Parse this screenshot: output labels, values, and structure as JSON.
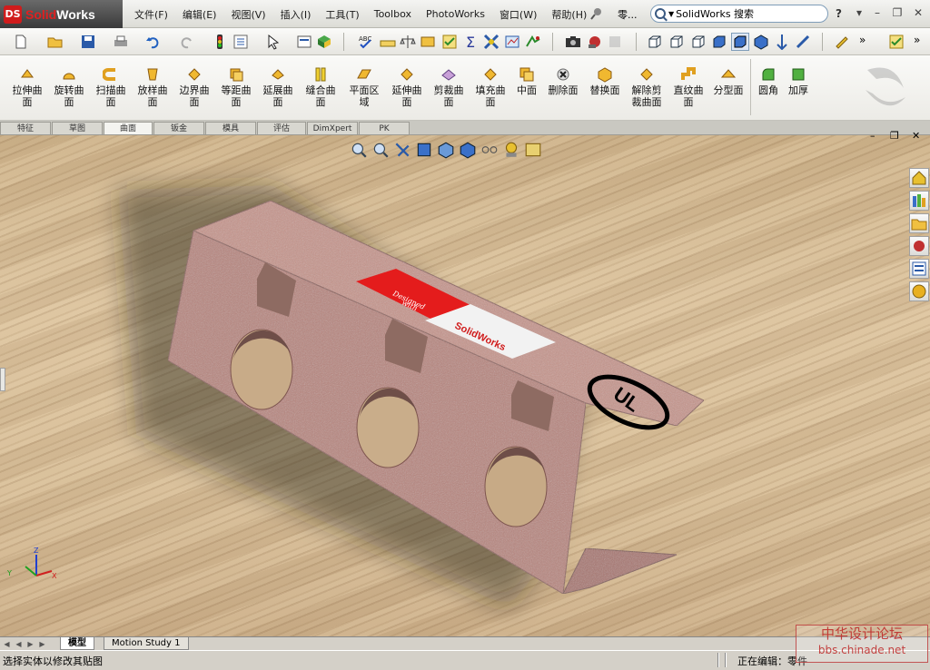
{
  "app": {
    "brand_prefix": "Solid",
    "brand_suffix": "Works",
    "document_label": "零...",
    "search_text": "SolidWorks 搜索",
    "help": "?"
  },
  "menu": [
    "文件(F)",
    "编辑(E)",
    "视图(V)",
    "插入(I)",
    "工具(T)",
    "Toolbox",
    "PhotoWorks",
    "窗口(W)",
    "帮助(H)"
  ],
  "window_buttons": {
    "minimize": "–",
    "restore": "❐",
    "close": "✕"
  },
  "ribbon": {
    "commands": [
      {
        "l1": "拉伸曲",
        "l2": "面"
      },
      {
        "l1": "旋转曲",
        "l2": "面"
      },
      {
        "l1": "扫描曲",
        "l2": "面"
      },
      {
        "l1": "放样曲",
        "l2": "面"
      },
      {
        "l1": "边界曲",
        "l2": "面"
      },
      {
        "l1": "等距曲",
        "l2": "面"
      },
      {
        "l1": "延展曲",
        "l2": "面"
      },
      {
        "l1": "缝合曲",
        "l2": "面"
      },
      {
        "l1": "平面区",
        "l2": "域"
      },
      {
        "l1": "延伸曲",
        "l2": "面"
      },
      {
        "l1": "剪裁曲",
        "l2": "面"
      },
      {
        "l1": "填充曲",
        "l2": "面"
      },
      {
        "l1": "中面",
        "l2": ""
      },
      {
        "l1": "删除面",
        "l2": ""
      },
      {
        "l1": "替换面",
        "l2": ""
      },
      {
        "l1": "解除剪",
        "l2": "裁曲面"
      },
      {
        "l1": "直纹曲",
        "l2": "面"
      },
      {
        "l1": "分型面",
        "l2": ""
      },
      {
        "l1": "圆角",
        "l2": ""
      },
      {
        "l1": "加厚",
        "l2": ""
      }
    ]
  },
  "tabs": [
    "特征",
    "草图",
    "曲面",
    "钣金",
    "模具",
    "评估",
    "DimXpert",
    "PK"
  ],
  "active_tab": "曲面",
  "model": {
    "label_red_text_1": "Designed",
    "label_red_text_2": "with",
    "label_brand": "SolidWorks",
    "ul_mark": "UL"
  },
  "triad": {
    "x": "X",
    "y": "Y",
    "z": "Z"
  },
  "bottom_tabs": [
    "模型",
    "Motion Study 1"
  ],
  "status": {
    "left": "选择实体以修改其贴图",
    "right": "正在编辑：零件"
  },
  "stamp": {
    "line1": "中华设计论坛",
    "line2": "bbs.chinade.net"
  },
  "colors": {
    "accent": "#d01c1c",
    "part": "#b98a84",
    "floor": "#d8be98"
  }
}
